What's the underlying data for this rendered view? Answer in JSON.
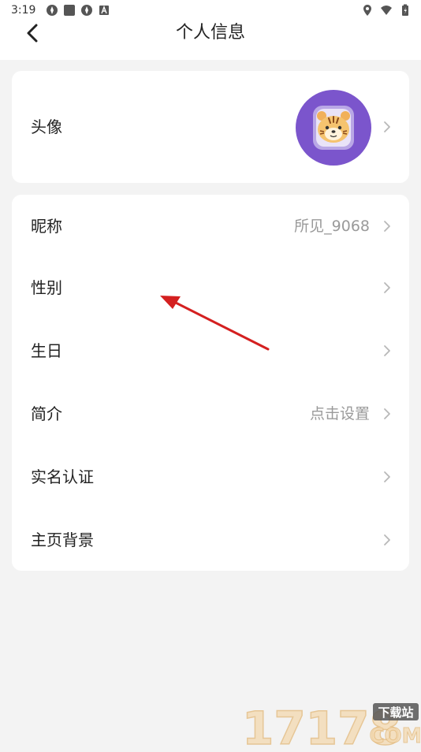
{
  "status_bar": {
    "time": "3:19"
  },
  "header": {
    "title": "个人信息",
    "back_icon": "back-arrow-icon"
  },
  "profile_card": {
    "avatar_label": "头像",
    "avatar_icon": "tiger-avatar-icon"
  },
  "info_rows": [
    {
      "label": "昵称",
      "value": "所见_9068"
    },
    {
      "label": "性别",
      "value": ""
    },
    {
      "label": "生日",
      "value": ""
    },
    {
      "label": "简介",
      "value": "点击设置"
    },
    {
      "label": "实名认证",
      "value": ""
    },
    {
      "label": "主页背景",
      "value": ""
    }
  ],
  "watermark": {
    "number": "17178",
    "tag": "下载站",
    "domain": "COM"
  },
  "colors": {
    "avatar_bg": "#7b55cc",
    "annotation_arrow": "#d42020"
  }
}
